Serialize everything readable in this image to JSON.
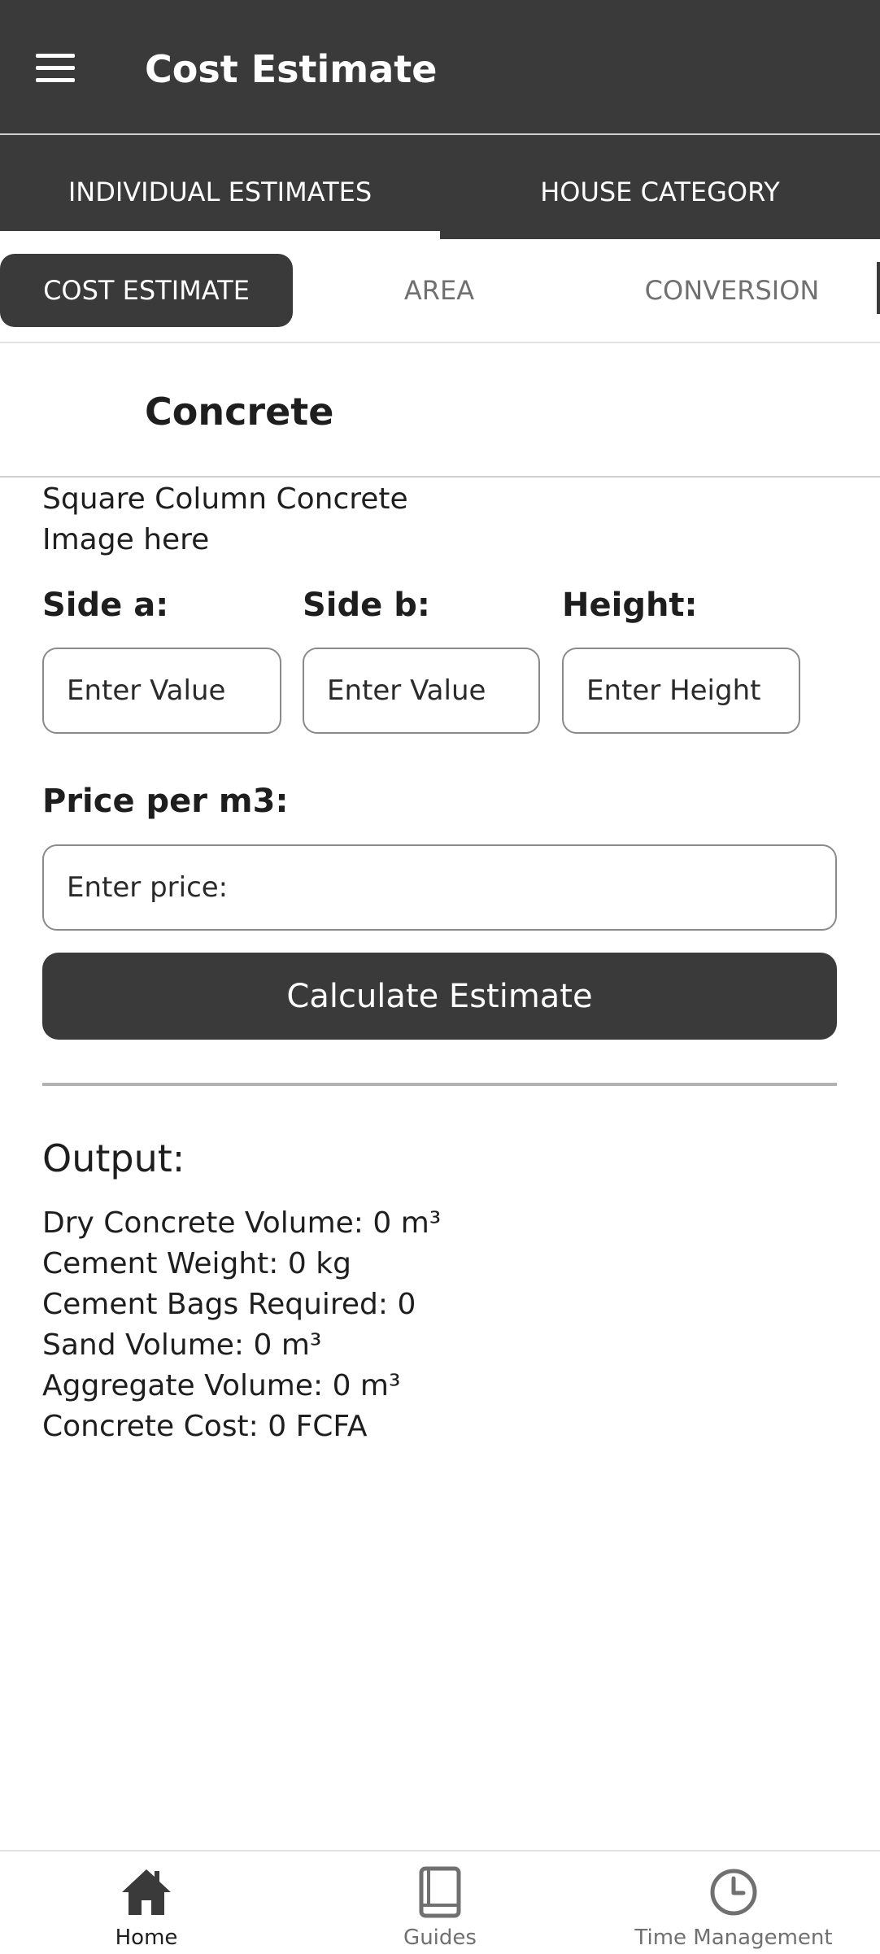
{
  "appbar": {
    "title": "Cost Estimate",
    "menu_icon": "hamburger-menu-icon"
  },
  "main_tabs": [
    {
      "label": "INDIVIDUAL ESTIMATES",
      "active": true
    },
    {
      "label": "HOUSE CATEGORY",
      "active": false
    }
  ],
  "sub_tabs": [
    {
      "label": "COST ESTIMATE",
      "active": true
    },
    {
      "label": "AREA",
      "active": false
    },
    {
      "label": "CONVERSION",
      "active": false
    }
  ],
  "section": {
    "title": "Concrete"
  },
  "content": {
    "subtitle": "Square Column Concrete",
    "image_placeholder": "Image here",
    "side_a_label": "Side a:",
    "side_a_placeholder": "Enter Value",
    "side_b_label": "Side b:",
    "side_b_placeholder": "Enter Value",
    "height_label": "Height:",
    "height_placeholder": "Enter Height",
    "price_label": "Price per m3:",
    "price_placeholder": "Enter price:",
    "calculate_label": "Calculate Estimate"
  },
  "output": {
    "title": "Output:",
    "lines": [
      "Dry Concrete Volume: 0 m³",
      "Cement Weight: 0 kg",
      "Cement Bags Required: 0",
      "Sand Volume: 0 m³",
      "Aggregate Volume: 0 m³",
      "Concrete Cost: 0 FCFA"
    ]
  },
  "bottom_nav": [
    {
      "label": "Home",
      "icon": "home-icon",
      "active": true
    },
    {
      "label": "Guides",
      "icon": "book-icon",
      "active": false
    },
    {
      "label": "Time Management",
      "icon": "clock-icon",
      "active": false
    }
  ],
  "colors": {
    "primary": "#3a3a3a",
    "background": "#ffffff",
    "muted_text": "#707070"
  }
}
